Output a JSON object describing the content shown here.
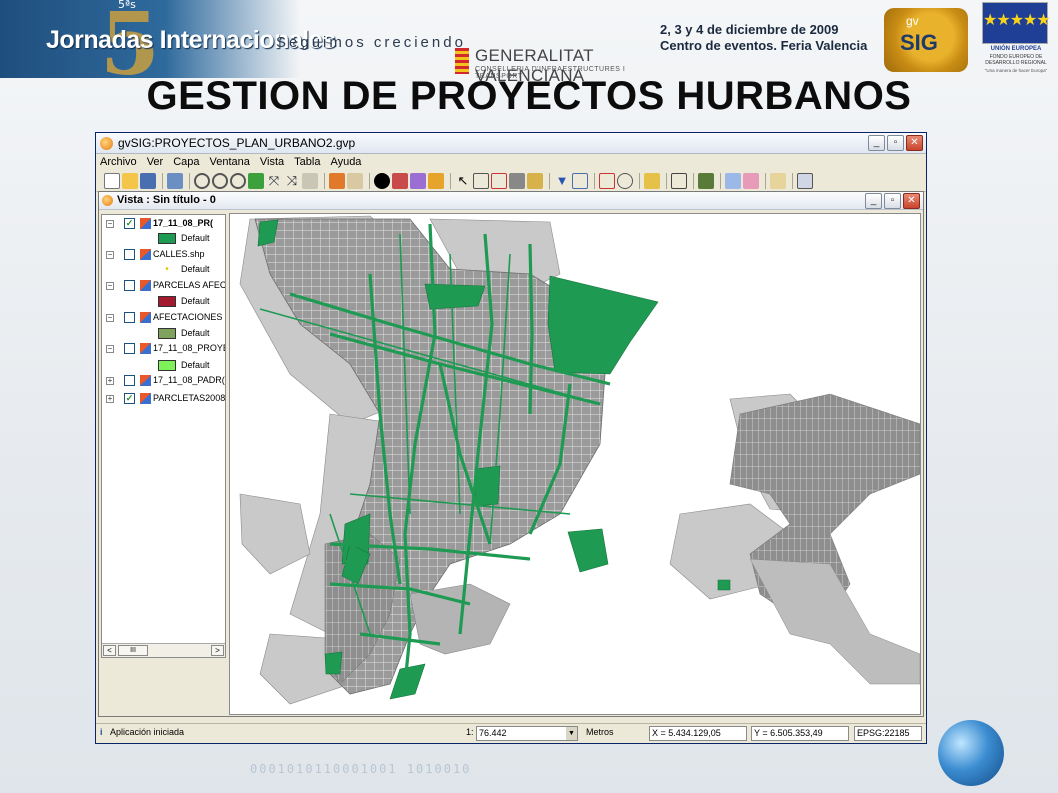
{
  "slide": {
    "event_edition": "5ªs",
    "event_title": "Jornadas Internacionales",
    "event_tagline": "Seguimos creciendo",
    "event_date_line1": "2, 3 y 4 de diciembre de 2009",
    "event_date_line2": "Centro de eventos. Feria Valencia",
    "sponsor_name": "GENERALITAT VALENCIANA",
    "sponsor_sub": "CONSELLERIA D'INFRAESTRUCTURES I TRANSPORT",
    "gvsig_logo_top": "gv",
    "gvsig_logo_bottom": "SIG",
    "eu_title": "UNIÓN EUROPEA",
    "eu_fund": "FONDO EUROPEO DE DESARROLLO REGIONAL",
    "eu_motto": "\"Una manera de hacer Europa\"",
    "title": "GESTION DE PROYECTOS HURBANOS",
    "binary_strip": "0001010110001001 1010010"
  },
  "app": {
    "window_title": "gvSIG:PROYECTOS_PLAN_URBANO2.gvp",
    "menus": [
      "Archivo",
      "Ver",
      "Capa",
      "Ventana",
      "Vista",
      "Tabla",
      "Ayuda"
    ],
    "window_buttons": {
      "minimize": "_",
      "restore": "▫",
      "close": "✕"
    },
    "view": {
      "title": "Vista : Sin título - 0"
    },
    "toc": {
      "layers": [
        {
          "name": "17_11_08_PR(",
          "checked": true,
          "legend": "Default",
          "swatch": "#1e9a52",
          "bold": true
        },
        {
          "name": "CALLES.shp",
          "checked": false,
          "legend": "Default",
          "swatch": "#f2e84a"
        },
        {
          "name": "PARCELAS AFECT",
          "checked": false,
          "legend": "Default",
          "swatch": "#a31a2e"
        },
        {
          "name": "AFECTACIONES /",
          "checked": false,
          "legend": "Default",
          "swatch": "#7fa35c"
        },
        {
          "name": "17_11_08_PROYE",
          "checked": false,
          "legend": "Default",
          "swatch": "#7ef05a"
        },
        {
          "name": "17_11_08_PADR(",
          "checked": false
        },
        {
          "name": "PARCLETAS2008",
          "checked": true
        }
      ],
      "scroll_left": "<",
      "scroll_right": ">",
      "scroll_thumb": "III"
    },
    "status": {
      "message": "Aplicación iniciada",
      "scale_prefix": "1:",
      "scale_value": "76.442",
      "units": "Metros",
      "x": "X = 5.434.129,05",
      "y": "Y = 6.505.353,49",
      "epsg": "EPSG:22185"
    }
  },
  "colors": {
    "highlight_layer": "#1e9a52",
    "parcel_gray": "#8f8f8f",
    "street_gray": "#b3b3b3"
  }
}
